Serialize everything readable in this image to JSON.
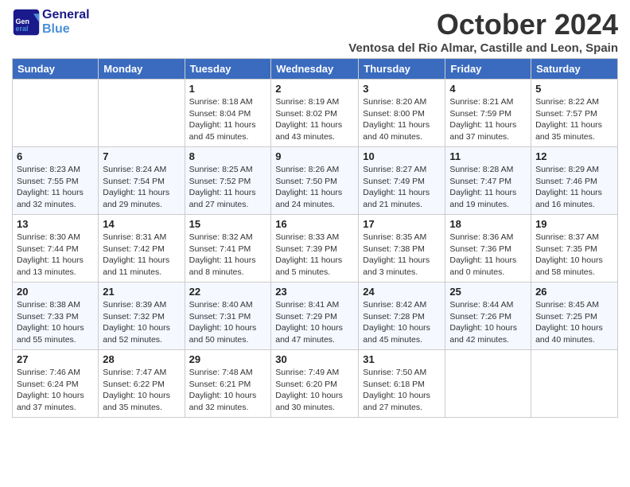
{
  "header": {
    "logo_general": "General",
    "logo_blue": "Blue",
    "month_title": "October 2024",
    "subtitle": "Ventosa del Rio Almar, Castille and Leon, Spain"
  },
  "days_of_week": [
    "Sunday",
    "Monday",
    "Tuesday",
    "Wednesday",
    "Thursday",
    "Friday",
    "Saturday"
  ],
  "weeks": [
    [
      {
        "day": "",
        "sunrise": "",
        "sunset": "",
        "daylight": ""
      },
      {
        "day": "",
        "sunrise": "",
        "sunset": "",
        "daylight": ""
      },
      {
        "day": "1",
        "sunrise": "Sunrise: 8:18 AM",
        "sunset": "Sunset: 8:04 PM",
        "daylight": "Daylight: 11 hours and 45 minutes."
      },
      {
        "day": "2",
        "sunrise": "Sunrise: 8:19 AM",
        "sunset": "Sunset: 8:02 PM",
        "daylight": "Daylight: 11 hours and 43 minutes."
      },
      {
        "day": "3",
        "sunrise": "Sunrise: 8:20 AM",
        "sunset": "Sunset: 8:00 PM",
        "daylight": "Daylight: 11 hours and 40 minutes."
      },
      {
        "day": "4",
        "sunrise": "Sunrise: 8:21 AM",
        "sunset": "Sunset: 7:59 PM",
        "daylight": "Daylight: 11 hours and 37 minutes."
      },
      {
        "day": "5",
        "sunrise": "Sunrise: 8:22 AM",
        "sunset": "Sunset: 7:57 PM",
        "daylight": "Daylight: 11 hours and 35 minutes."
      }
    ],
    [
      {
        "day": "6",
        "sunrise": "Sunrise: 8:23 AM",
        "sunset": "Sunset: 7:55 PM",
        "daylight": "Daylight: 11 hours and 32 minutes."
      },
      {
        "day": "7",
        "sunrise": "Sunrise: 8:24 AM",
        "sunset": "Sunset: 7:54 PM",
        "daylight": "Daylight: 11 hours and 29 minutes."
      },
      {
        "day": "8",
        "sunrise": "Sunrise: 8:25 AM",
        "sunset": "Sunset: 7:52 PM",
        "daylight": "Daylight: 11 hours and 27 minutes."
      },
      {
        "day": "9",
        "sunrise": "Sunrise: 8:26 AM",
        "sunset": "Sunset: 7:50 PM",
        "daylight": "Daylight: 11 hours and 24 minutes."
      },
      {
        "day": "10",
        "sunrise": "Sunrise: 8:27 AM",
        "sunset": "Sunset: 7:49 PM",
        "daylight": "Daylight: 11 hours and 21 minutes."
      },
      {
        "day": "11",
        "sunrise": "Sunrise: 8:28 AM",
        "sunset": "Sunset: 7:47 PM",
        "daylight": "Daylight: 11 hours and 19 minutes."
      },
      {
        "day": "12",
        "sunrise": "Sunrise: 8:29 AM",
        "sunset": "Sunset: 7:46 PM",
        "daylight": "Daylight: 11 hours and 16 minutes."
      }
    ],
    [
      {
        "day": "13",
        "sunrise": "Sunrise: 8:30 AM",
        "sunset": "Sunset: 7:44 PM",
        "daylight": "Daylight: 11 hours and 13 minutes."
      },
      {
        "day": "14",
        "sunrise": "Sunrise: 8:31 AM",
        "sunset": "Sunset: 7:42 PM",
        "daylight": "Daylight: 11 hours and 11 minutes."
      },
      {
        "day": "15",
        "sunrise": "Sunrise: 8:32 AM",
        "sunset": "Sunset: 7:41 PM",
        "daylight": "Daylight: 11 hours and 8 minutes."
      },
      {
        "day": "16",
        "sunrise": "Sunrise: 8:33 AM",
        "sunset": "Sunset: 7:39 PM",
        "daylight": "Daylight: 11 hours and 5 minutes."
      },
      {
        "day": "17",
        "sunrise": "Sunrise: 8:35 AM",
        "sunset": "Sunset: 7:38 PM",
        "daylight": "Daylight: 11 hours and 3 minutes."
      },
      {
        "day": "18",
        "sunrise": "Sunrise: 8:36 AM",
        "sunset": "Sunset: 7:36 PM",
        "daylight": "Daylight: 11 hours and 0 minutes."
      },
      {
        "day": "19",
        "sunrise": "Sunrise: 8:37 AM",
        "sunset": "Sunset: 7:35 PM",
        "daylight": "Daylight: 10 hours and 58 minutes."
      }
    ],
    [
      {
        "day": "20",
        "sunrise": "Sunrise: 8:38 AM",
        "sunset": "Sunset: 7:33 PM",
        "daylight": "Daylight: 10 hours and 55 minutes."
      },
      {
        "day": "21",
        "sunrise": "Sunrise: 8:39 AM",
        "sunset": "Sunset: 7:32 PM",
        "daylight": "Daylight: 10 hours and 52 minutes."
      },
      {
        "day": "22",
        "sunrise": "Sunrise: 8:40 AM",
        "sunset": "Sunset: 7:31 PM",
        "daylight": "Daylight: 10 hours and 50 minutes."
      },
      {
        "day": "23",
        "sunrise": "Sunrise: 8:41 AM",
        "sunset": "Sunset: 7:29 PM",
        "daylight": "Daylight: 10 hours and 47 minutes."
      },
      {
        "day": "24",
        "sunrise": "Sunrise: 8:42 AM",
        "sunset": "Sunset: 7:28 PM",
        "daylight": "Daylight: 10 hours and 45 minutes."
      },
      {
        "day": "25",
        "sunrise": "Sunrise: 8:44 AM",
        "sunset": "Sunset: 7:26 PM",
        "daylight": "Daylight: 10 hours and 42 minutes."
      },
      {
        "day": "26",
        "sunrise": "Sunrise: 8:45 AM",
        "sunset": "Sunset: 7:25 PM",
        "daylight": "Daylight: 10 hours and 40 minutes."
      }
    ],
    [
      {
        "day": "27",
        "sunrise": "Sunrise: 7:46 AM",
        "sunset": "Sunset: 6:24 PM",
        "daylight": "Daylight: 10 hours and 37 minutes."
      },
      {
        "day": "28",
        "sunrise": "Sunrise: 7:47 AM",
        "sunset": "Sunset: 6:22 PM",
        "daylight": "Daylight: 10 hours and 35 minutes."
      },
      {
        "day": "29",
        "sunrise": "Sunrise: 7:48 AM",
        "sunset": "Sunset: 6:21 PM",
        "daylight": "Daylight: 10 hours and 32 minutes."
      },
      {
        "day": "30",
        "sunrise": "Sunrise: 7:49 AM",
        "sunset": "Sunset: 6:20 PM",
        "daylight": "Daylight: 10 hours and 30 minutes."
      },
      {
        "day": "31",
        "sunrise": "Sunrise: 7:50 AM",
        "sunset": "Sunset: 6:18 PM",
        "daylight": "Daylight: 10 hours and 27 minutes."
      },
      {
        "day": "",
        "sunrise": "",
        "sunset": "",
        "daylight": ""
      },
      {
        "day": "",
        "sunrise": "",
        "sunset": "",
        "daylight": ""
      }
    ]
  ]
}
